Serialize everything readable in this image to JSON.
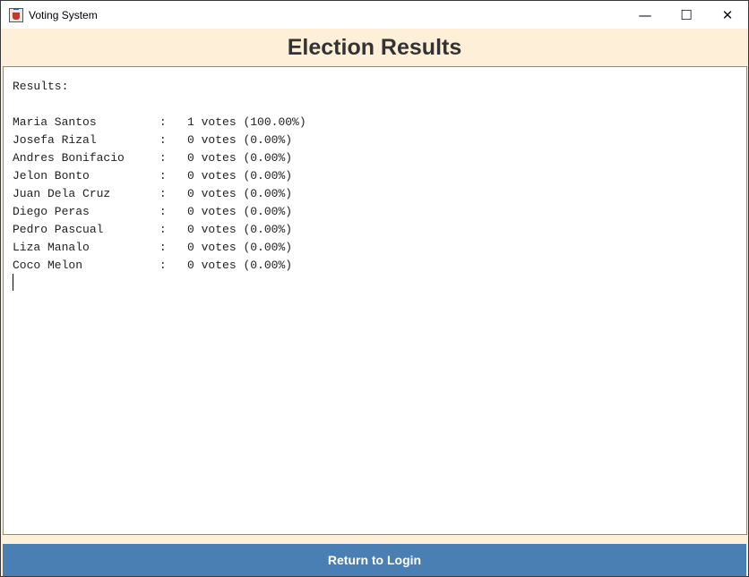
{
  "window": {
    "title": "Voting System",
    "icon": "java-app-icon",
    "controls": {
      "minimize": "—",
      "maximize": "☐",
      "close": "✕"
    }
  },
  "header": {
    "title": "Election Results"
  },
  "results": {
    "heading": "Results:",
    "rows": [
      {
        "name": "Maria Santos",
        "votes": "1",
        "percent": "100.00%"
      },
      {
        "name": "Josefa Rizal",
        "votes": "0",
        "percent": "0.00%"
      },
      {
        "name": "Andres Bonifacio",
        "votes": "0",
        "percent": "0.00%"
      },
      {
        "name": "Jelon Bonto",
        "votes": "0",
        "percent": "0.00%"
      },
      {
        "name": "Juan Dela Cruz",
        "votes": "0",
        "percent": "0.00%"
      },
      {
        "name": "Diego Peras",
        "votes": "0",
        "percent": "0.00%"
      },
      {
        "name": "Pedro Pascual",
        "votes": "0",
        "percent": "0.00%"
      },
      {
        "name": "Liza Manalo",
        "votes": "0",
        "percent": "0.00%"
      },
      {
        "name": "Coco Melon",
        "votes": "0",
        "percent": "0.00%"
      }
    ]
  },
  "footer": {
    "button_label": "Return to Login"
  },
  "colors": {
    "header_bg": "#fdefd8",
    "button_bg": "#4a7fb4",
    "title_text": "#333333"
  }
}
